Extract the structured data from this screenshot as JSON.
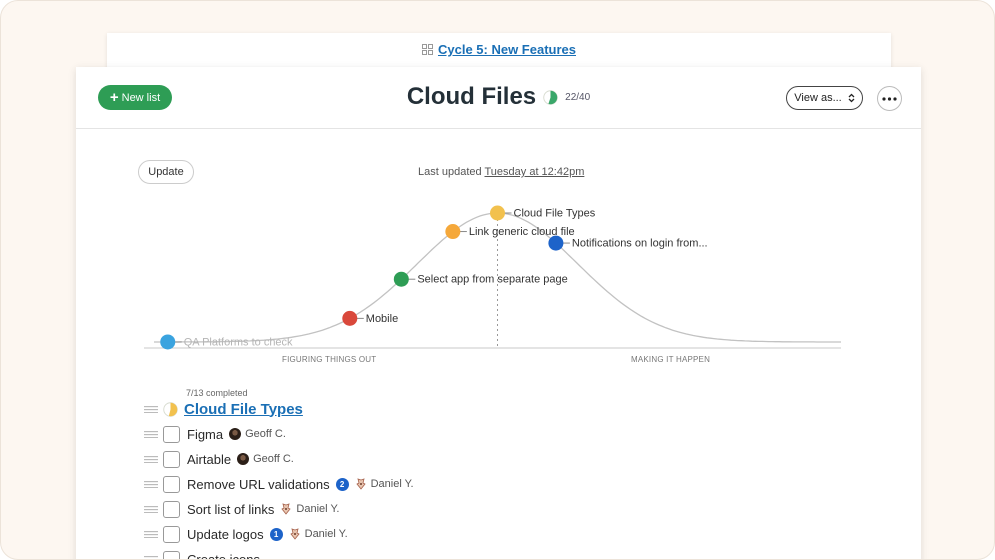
{
  "back_card": {
    "title": "Cycle 5: New Features",
    "icon": "grid-icon"
  },
  "header": {
    "new_list_label": "New list",
    "title": "Cloud Files",
    "progress_text": "22/40",
    "progress_fraction": 0.55,
    "view_as_label": "View as...",
    "colors": {
      "green": "#2e9d55"
    }
  },
  "hill_chart": {
    "update_label": "Update",
    "last_updated_prefix": "Last updated",
    "last_updated_when": "Tuesday at 12:42pm",
    "phase_left": "FIGURING THINGS OUT",
    "phase_right": "MAKING IT HAPPEN",
    "scopes": [
      {
        "label": "QA Platforms to check",
        "position": 0.02,
        "color": "#3aa3df",
        "muted": true
      },
      {
        "label": "Mobile",
        "position": 0.285,
        "color": "#d9483b",
        "muted": false
      },
      {
        "label": "Select app from separate page",
        "position": 0.36,
        "color": "#2e9d55",
        "muted": false
      },
      {
        "label": "Link generic cloud file",
        "position": 0.435,
        "color": "#f5a83a",
        "muted": false
      },
      {
        "label": "Cloud File Types",
        "position": 0.5,
        "color": "#f2c14e",
        "muted": false
      },
      {
        "label": "Notifications on login from...",
        "position": 0.585,
        "color": "#1d63c9",
        "muted": false
      }
    ]
  },
  "scope_list": {
    "completed_text": "7/13 completed",
    "scope_title": "Cloud File Types",
    "scope_fraction": 0.54,
    "tasks": [
      {
        "title": "Figma",
        "assignee": "Geoff C.",
        "avatar": "dark",
        "badge": ""
      },
      {
        "title": "Airtable",
        "assignee": "Geoff C.",
        "avatar": "dark",
        "badge": ""
      },
      {
        "title": "Remove URL validations",
        "assignee": "Daniel Y.",
        "avatar": "bird",
        "badge": "2"
      },
      {
        "title": "Sort list of links",
        "assignee": "Daniel Y.",
        "avatar": "bird",
        "badge": ""
      },
      {
        "title": "Update logos",
        "assignee": "Daniel Y.",
        "avatar": "bird",
        "badge": "1"
      },
      {
        "title": "Create icons",
        "assignee": "",
        "avatar": "",
        "badge": ""
      }
    ]
  }
}
